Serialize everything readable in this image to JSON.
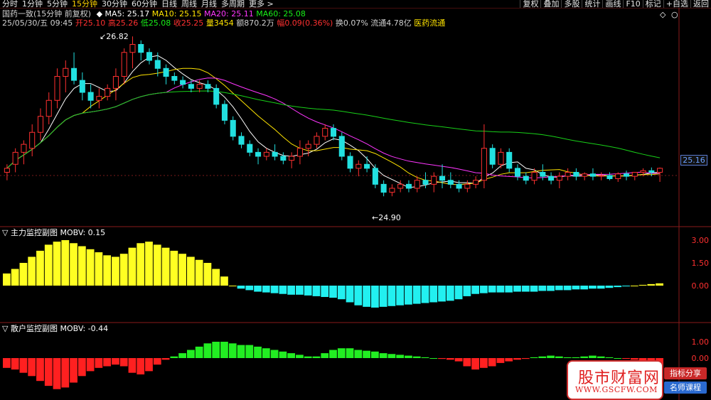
{
  "toolbar": {
    "tabs": [
      "分时",
      "1分钟",
      "5分钟",
      "15分钟",
      "30分钟",
      "60分钟",
      "日线",
      "周线",
      "月线",
      "多周期",
      "更多 >"
    ],
    "active_index": 3,
    "right": [
      "复权",
      "叠加",
      "多股",
      "统计",
      "画线",
      "F10",
      "标记",
      "+自选",
      "返回"
    ]
  },
  "main_panel": {
    "title": "国药一致(15分钟 前复权)",
    "ma5": "MA5: 25.17",
    "ma10": "MA10: 25.15",
    "ma20": "MA20: 25.11",
    "ma60": "MA60: 25.08",
    "date": "25/05/30/五 09:45",
    "open_label": "开",
    "open": "25.10",
    "high_label": "高",
    "high": "25.26",
    "low_label": "低",
    "low": "25.08",
    "close_label": "收",
    "close": "25.25",
    "vol_label": "量",
    "vol": "3454",
    "amount": "额870.2万",
    "change_label": "幅",
    "change": "0.09(0.36%)",
    "turnover": "换0.07%",
    "float_cap": "流通4.78亿",
    "sector": "医药流通",
    "high_marker": "26.82",
    "low_marker": "24.90",
    "price_tag": "25.16",
    "y_axis": [
      "25.16"
    ],
    "icons": [
      "diamond-icon",
      "circle-icon"
    ]
  },
  "mid_panel": {
    "title": "主力监控副图",
    "indicator": "MOBV: 0.15",
    "y_axis": [
      "3.00",
      "1.50",
      "0.00"
    ]
  },
  "bottom_panel": {
    "title": "散户监控副图",
    "indicator": "MOBV: -0.44",
    "y_axis": [
      "1.00",
      "0.00"
    ]
  },
  "watermark": {
    "name": "股市财富网",
    "url": "WWW.GSCFW.COM",
    "tag1": "指标分享",
    "tag2": "名师课程"
  },
  "chart_data": {
    "type": "candlestick",
    "price_axis": {
      "min": 24.6,
      "max": 27.0
    },
    "candles": [
      [
        25.2,
        25.3,
        25.1,
        25.25
      ],
      [
        25.3,
        25.5,
        25.2,
        25.45
      ],
      [
        25.45,
        25.6,
        25.3,
        25.55
      ],
      [
        25.5,
        25.8,
        25.4,
        25.7
      ],
      [
        25.7,
        26.0,
        25.6,
        25.9
      ],
      [
        25.9,
        26.2,
        25.8,
        26.1
      ],
      [
        26.1,
        26.5,
        26.0,
        26.4
      ],
      [
        26.4,
        26.6,
        26.2,
        26.5
      ],
      [
        26.5,
        26.7,
        26.3,
        26.35
      ],
      [
        26.35,
        26.45,
        26.1,
        26.2
      ],
      [
        26.2,
        26.3,
        26.0,
        26.1
      ],
      [
        26.1,
        26.25,
        26.0,
        26.15
      ],
      [
        26.15,
        26.3,
        26.1,
        26.25
      ],
      [
        26.25,
        26.5,
        26.1,
        26.4
      ],
      [
        26.4,
        26.75,
        26.3,
        26.7
      ],
      [
        26.7,
        26.9,
        26.5,
        26.8
      ],
      [
        26.8,
        26.85,
        26.6,
        26.7
      ],
      [
        26.7,
        26.75,
        26.55,
        26.6
      ],
      [
        26.6,
        26.7,
        26.4,
        26.5
      ],
      [
        26.5,
        26.55,
        26.3,
        26.4
      ],
      [
        26.4,
        26.45,
        26.3,
        26.35
      ],
      [
        26.35,
        26.4,
        26.25,
        26.3
      ],
      [
        26.3,
        26.35,
        26.2,
        26.25
      ],
      [
        26.25,
        26.35,
        26.2,
        26.3
      ],
      [
        26.3,
        26.35,
        26.2,
        26.25
      ],
      [
        26.25,
        26.3,
        26.0,
        26.05
      ],
      [
        26.05,
        26.1,
        25.8,
        25.85
      ],
      [
        25.85,
        25.9,
        25.6,
        25.65
      ],
      [
        25.65,
        25.7,
        25.5,
        25.55
      ],
      [
        25.55,
        25.6,
        25.4,
        25.45
      ],
      [
        25.45,
        25.5,
        25.3,
        25.4
      ],
      [
        25.4,
        25.5,
        25.35,
        25.45
      ],
      [
        25.45,
        25.55,
        25.35,
        25.4
      ],
      [
        25.4,
        25.45,
        25.3,
        25.35
      ],
      [
        25.35,
        25.45,
        25.25,
        25.4
      ],
      [
        25.4,
        25.6,
        25.3,
        25.5
      ],
      [
        25.5,
        25.6,
        25.4,
        25.55
      ],
      [
        25.55,
        25.7,
        25.5,
        25.65
      ],
      [
        25.65,
        25.8,
        25.6,
        25.75
      ],
      [
        25.75,
        25.8,
        25.6,
        25.65
      ],
      [
        25.65,
        25.7,
        25.35,
        25.4
      ],
      [
        25.4,
        25.45,
        25.2,
        25.25
      ],
      [
        25.25,
        25.35,
        25.15,
        25.3
      ],
      [
        25.3,
        25.4,
        25.2,
        25.25
      ],
      [
        25.25,
        25.3,
        25.0,
        25.05
      ],
      [
        25.05,
        25.1,
        24.9,
        24.95
      ],
      [
        24.95,
        25.05,
        24.9,
        25.0
      ],
      [
        25.0,
        25.1,
        24.95,
        25.05
      ],
      [
        25.05,
        25.1,
        24.95,
        25.0
      ],
      [
        25.0,
        25.15,
        24.95,
        25.1
      ],
      [
        25.1,
        25.2,
        25.0,
        25.05
      ],
      [
        25.05,
        25.2,
        24.95,
        25.15
      ],
      [
        25.15,
        25.3,
        25.0,
        25.1
      ],
      [
        25.1,
        25.2,
        25.0,
        25.05
      ],
      [
        25.05,
        25.1,
        24.95,
        25.0
      ],
      [
        25.0,
        25.1,
        24.95,
        25.05
      ],
      [
        25.05,
        25.15,
        25.0,
        25.1
      ],
      [
        25.1,
        25.8,
        25.0,
        25.5
      ],
      [
        25.5,
        25.55,
        25.25,
        25.3
      ],
      [
        25.3,
        25.5,
        25.25,
        25.45
      ],
      [
        25.45,
        25.5,
        25.2,
        25.25
      ],
      [
        25.25,
        25.3,
        25.1,
        25.15
      ],
      [
        25.15,
        25.2,
        25.05,
        25.1
      ],
      [
        25.1,
        25.25,
        25.05,
        25.2
      ],
      [
        25.2,
        25.3,
        25.1,
        25.15
      ],
      [
        25.15,
        25.2,
        25.05,
        25.1
      ],
      [
        25.1,
        25.2,
        25.0,
        25.15
      ],
      [
        25.15,
        25.25,
        25.1,
        25.2
      ],
      [
        25.2,
        25.25,
        25.1,
        25.15
      ],
      [
        25.15,
        25.2,
        25.1,
        25.18
      ],
      [
        25.18,
        25.25,
        25.1,
        25.15
      ],
      [
        25.15,
        25.2,
        25.1,
        25.16
      ],
      [
        25.16,
        25.2,
        25.1,
        25.12
      ],
      [
        25.12,
        25.2,
        25.08,
        25.18
      ],
      [
        25.18,
        25.22,
        25.1,
        25.15
      ],
      [
        25.15,
        25.2,
        25.1,
        25.2
      ],
      [
        25.2,
        25.25,
        25.15,
        25.22
      ],
      [
        25.22,
        25.26,
        25.15,
        25.2
      ],
      [
        25.2,
        25.26,
        25.08,
        25.25
      ]
    ],
    "mobv_main": [
      0.8,
      1.1,
      1.5,
      1.9,
      2.3,
      2.7,
      2.9,
      3.0,
      2.8,
      2.6,
      2.4,
      2.2,
      2.0,
      1.9,
      2.1,
      2.5,
      2.8,
      2.9,
      2.7,
      2.5,
      2.3,
      2.1,
      1.9,
      1.7,
      1.5,
      1.1,
      0.6,
      0.0,
      -0.2,
      -0.3,
      -0.4,
      -0.45,
      -0.5,
      -0.55,
      -0.6,
      -0.6,
      -0.65,
      -0.7,
      -0.75,
      -0.8,
      -0.9,
      -1.1,
      -1.3,
      -1.4,
      -1.45,
      -1.4,
      -1.35,
      -1.3,
      -1.25,
      -1.2,
      -1.15,
      -1.1,
      -1.05,
      -1.0,
      -0.9,
      -0.7,
      -0.55,
      -0.5,
      -0.45,
      -0.45,
      -0.45,
      -0.4,
      -0.4,
      -0.4,
      -0.35,
      -0.35,
      -0.3,
      -0.3,
      -0.25,
      -0.25,
      -0.2,
      -0.2,
      -0.15,
      -0.1,
      -0.05,
      0.0,
      0.05,
      0.1,
      0.15
    ],
    "mobv_retail": [
      -0.6,
      -0.7,
      -0.9,
      -1.1,
      -1.4,
      -1.7,
      -1.9,
      -1.8,
      -1.5,
      -1.1,
      -0.8,
      -0.6,
      -0.5,
      -0.4,
      -0.5,
      -0.9,
      -1.0,
      -0.8,
      -0.4,
      -0.1,
      0.1,
      0.3,
      0.5,
      0.7,
      0.9,
      1.0,
      1.0,
      0.9,
      0.8,
      0.8,
      0.7,
      0.6,
      0.5,
      0.4,
      0.3,
      0.2,
      0.1,
      0.1,
      0.3,
      0.5,
      0.6,
      0.6,
      0.5,
      0.45,
      0.4,
      0.3,
      0.25,
      0.2,
      0.15,
      0.1,
      0.05,
      0.0,
      -0.05,
      -0.1,
      -0.2,
      -0.5,
      -0.7,
      -0.6,
      -0.5,
      -0.3,
      -0.2,
      -0.1,
      -0.05,
      0.05,
      0.1,
      0.15,
      0.1,
      0.05,
      0.05,
      0.1,
      0.15,
      0.1,
      0.05,
      0.0,
      -0.05,
      -0.1,
      -0.2,
      -0.3,
      -0.44
    ]
  }
}
